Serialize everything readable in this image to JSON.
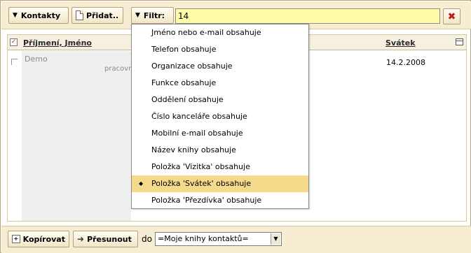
{
  "toolbar": {
    "contacts_label": "Kontakty",
    "add_label": "Přidat..",
    "filter_label": "Filtr:",
    "filter_value": "14",
    "clear_label": "✖"
  },
  "table": {
    "col_name": "Příjmení, Jméno",
    "col_holiday": "Svátek",
    "rows": [
      {
        "name": "Demo",
        "sub": "pracovn",
        "date": "14.2.2008"
      }
    ]
  },
  "dropdown": {
    "items": [
      {
        "label": "Jméno nebo e-mail obsahuje"
      },
      {
        "label": "Telefon obsahuje"
      },
      {
        "label": "Organizace obsahuje"
      },
      {
        "label": "Funkce obsahuje"
      },
      {
        "label": "Oddělení obsahuje"
      },
      {
        "label": "Číslo kanceláře obsahuje"
      },
      {
        "label": "Mobilní e-mail obsahuje"
      },
      {
        "label": "Název knihy obsahuje"
      },
      {
        "label": "Položka 'Vizitka' obsahuje"
      },
      {
        "label": "Položka 'Svátek' obsahuje",
        "selected": true
      },
      {
        "label": "Položka 'Přezdívka' obsahuje"
      }
    ]
  },
  "bottom": {
    "copy_label": "Kopírovat",
    "move_label": "Přesunout",
    "to_label": "do",
    "book_select": "=Moje knihy kontaktů="
  },
  "colors": {
    "toolbar_bg": "#f6edd2",
    "filter_bg": "#fffca8",
    "selected_bg": "#f5da8c",
    "clear_red": "#c21a1a"
  }
}
